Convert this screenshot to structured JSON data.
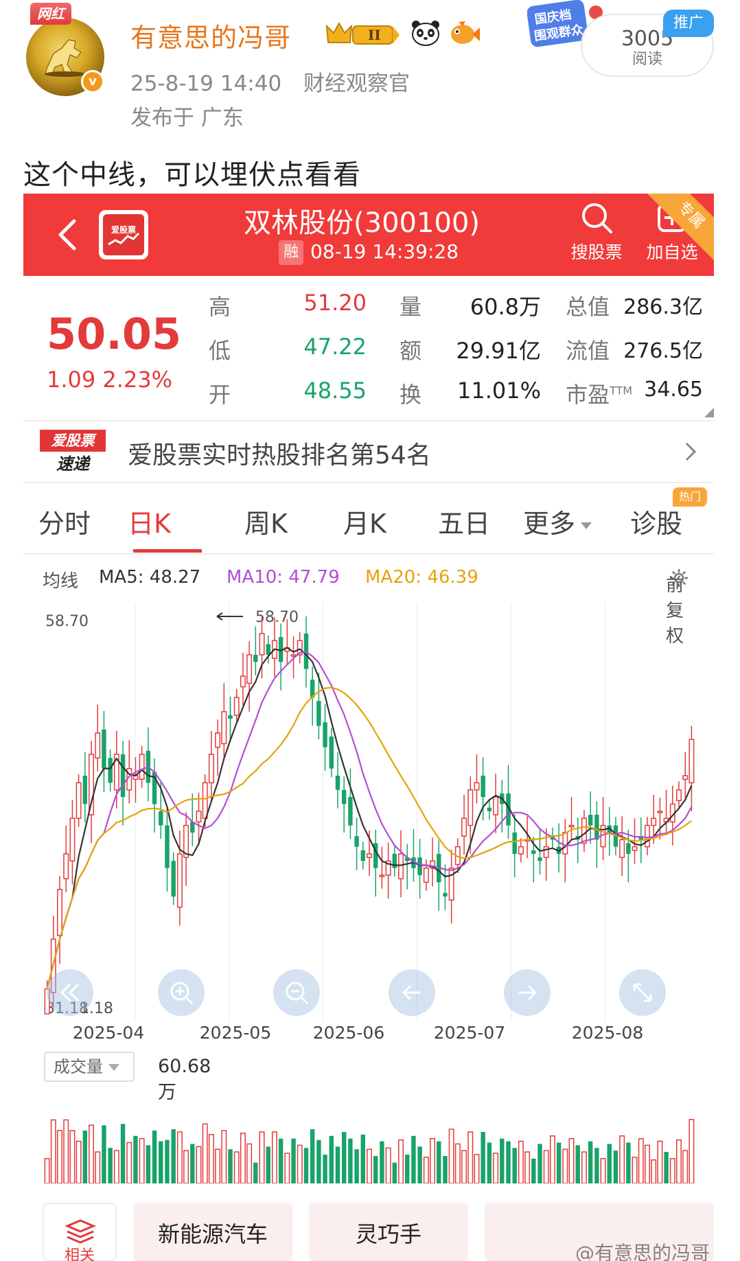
{
  "post": {
    "tag": "网红",
    "username": "有意思的冯哥",
    "level_badge": "II",
    "datetime": "25-8-19 14:40",
    "source": "财经观察官",
    "location": "发布于 广东",
    "read_count": "3005",
    "read_label": "阅读",
    "promo_tag": "推广",
    "promo_banner": "国庆档 围观群众",
    "text": "这个中线，可以埋伏点看看"
  },
  "stock": {
    "app_logo": "爱股票",
    "title": "双林股份(300100)",
    "rong": "融",
    "time": "08-19 14:39:28",
    "search_label": "搜股票",
    "add_label": "加自选",
    "corner_tag": "专属",
    "price": "50.05",
    "change": "1.09 2.23%",
    "rows": [
      {
        "l1": "高",
        "v1": "51.20",
        "c1": "red",
        "l2": "量",
        "v2": "60.8万",
        "l3": "总值",
        "v3": "286.3亿"
      },
      {
        "l1": "低",
        "v1": "47.22",
        "c1": "green",
        "l2": "额",
        "v2": "29.91亿",
        "l3": "流值",
        "v3": "276.5亿"
      },
      {
        "l1": "开",
        "v1": "48.55",
        "c1": "green",
        "l2": "换",
        "v2": "11.01%",
        "l3": "市盈",
        "l3_sup": "TTM",
        "v3": "34.65"
      }
    ]
  },
  "hot": {
    "logo_top": "爱股票",
    "logo_bottom": "速递",
    "text": "爱股票实时热股排名第54名"
  },
  "tabs": {
    "items": [
      "分时",
      "日K",
      "周K",
      "月K",
      "五日",
      "更多",
      "诊股"
    ],
    "active": "日K",
    "hot_badge": "热门"
  },
  "ma": {
    "label": "均线",
    "ma5": "MA5: 48.27",
    "ma10": "MA10: 47.79",
    "ma20": "MA20: 46.39",
    "fq": "前复权"
  },
  "chart_data": {
    "type": "candlestick",
    "y_max_label": "58.70",
    "y_min_label": "31.18",
    "min_marker_text": "1.18",
    "max_annotation": "58.70",
    "ylim": [
      31.18,
      58.7
    ],
    "dates": [
      "2025-04",
      "2025-05",
      "2025-06",
      "2025-07",
      "2025-08"
    ],
    "ma_colors": {
      "ma5": "#333333",
      "ma10": "#b24ed6",
      "ma20": "#e6a10a"
    },
    "up_color": "#e33a3a",
    "down_color": "#18a36a",
    "closes": [
      32.5,
      36,
      39.5,
      42,
      44.5,
      47,
      45.5,
      49,
      50.5,
      48,
      47,
      49,
      46,
      48,
      47.5,
      49,
      47,
      45.5,
      44,
      41,
      39,
      42,
      44,
      43.5,
      45,
      47,
      49,
      50.5,
      52,
      51.5,
      53,
      54.5,
      56,
      55.5,
      57.5,
      56,
      57,
      55.5,
      56.5,
      56,
      57,
      55,
      53,
      51,
      49.5,
      48,
      46.5,
      45.5,
      44,
      42.5,
      41.5,
      42,
      41,
      40.5,
      41.5,
      41,
      42,
      41.5,
      41,
      40.5,
      41,
      41.5,
      40,
      39,
      41,
      42.5,
      44.5,
      46.5,
      47,
      46,
      45,
      46,
      45.5,
      44,
      42,
      42.5,
      43,
      42,
      41.5,
      42.5,
      43,
      42,
      43.5,
      44,
      43,
      44.5,
      44,
      43,
      44,
      43.5,
      42.5,
      43,
      42,
      42.5,
      43,
      44,
      44.5,
      45,
      44.5,
      45.5,
      46.5,
      47.5,
      50.05
    ],
    "volume_label": "成交量",
    "volume_value": "60.68万"
  },
  "bottom": {
    "related_label": "相关",
    "cards": [
      "新能源汽车",
      "灵巧手",
      ""
    ]
  },
  "watermark": "@有意思的冯哥"
}
